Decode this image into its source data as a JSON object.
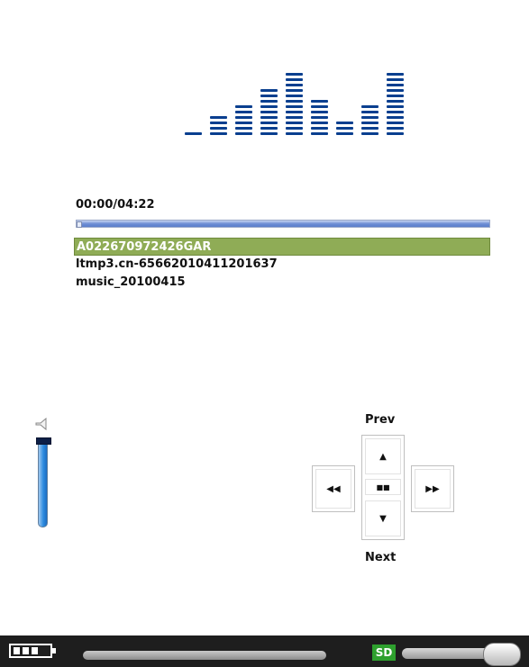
{
  "player": {
    "time": "00:00/04:22",
    "progress": 0.0,
    "equalizer_levels": [
      1,
      4,
      6,
      9,
      12,
      7,
      3,
      6,
      12
    ],
    "playlist": [
      {
        "title": "A022670972426GAR",
        "active": true
      },
      {
        "title": "ltmp3.cn-65662010411201637",
        "active": false
      },
      {
        "title": "music_20100415",
        "active": false
      }
    ]
  },
  "volume": {
    "level": 0.95
  },
  "dpad": {
    "prev_label": "Prev",
    "next_label": "Next",
    "up_icon": "▲",
    "down_icon": "▼",
    "rewind_icon": "◀◀",
    "forward_icon": "▶▶",
    "stop_icon": "■■"
  },
  "statusbar": {
    "sd_label": "SD",
    "battery_cells": 3
  },
  "colors": {
    "equalizer": "#0a3f8f",
    "playlist_active": "#8fac56",
    "sd_badge": "#2ea02e"
  }
}
